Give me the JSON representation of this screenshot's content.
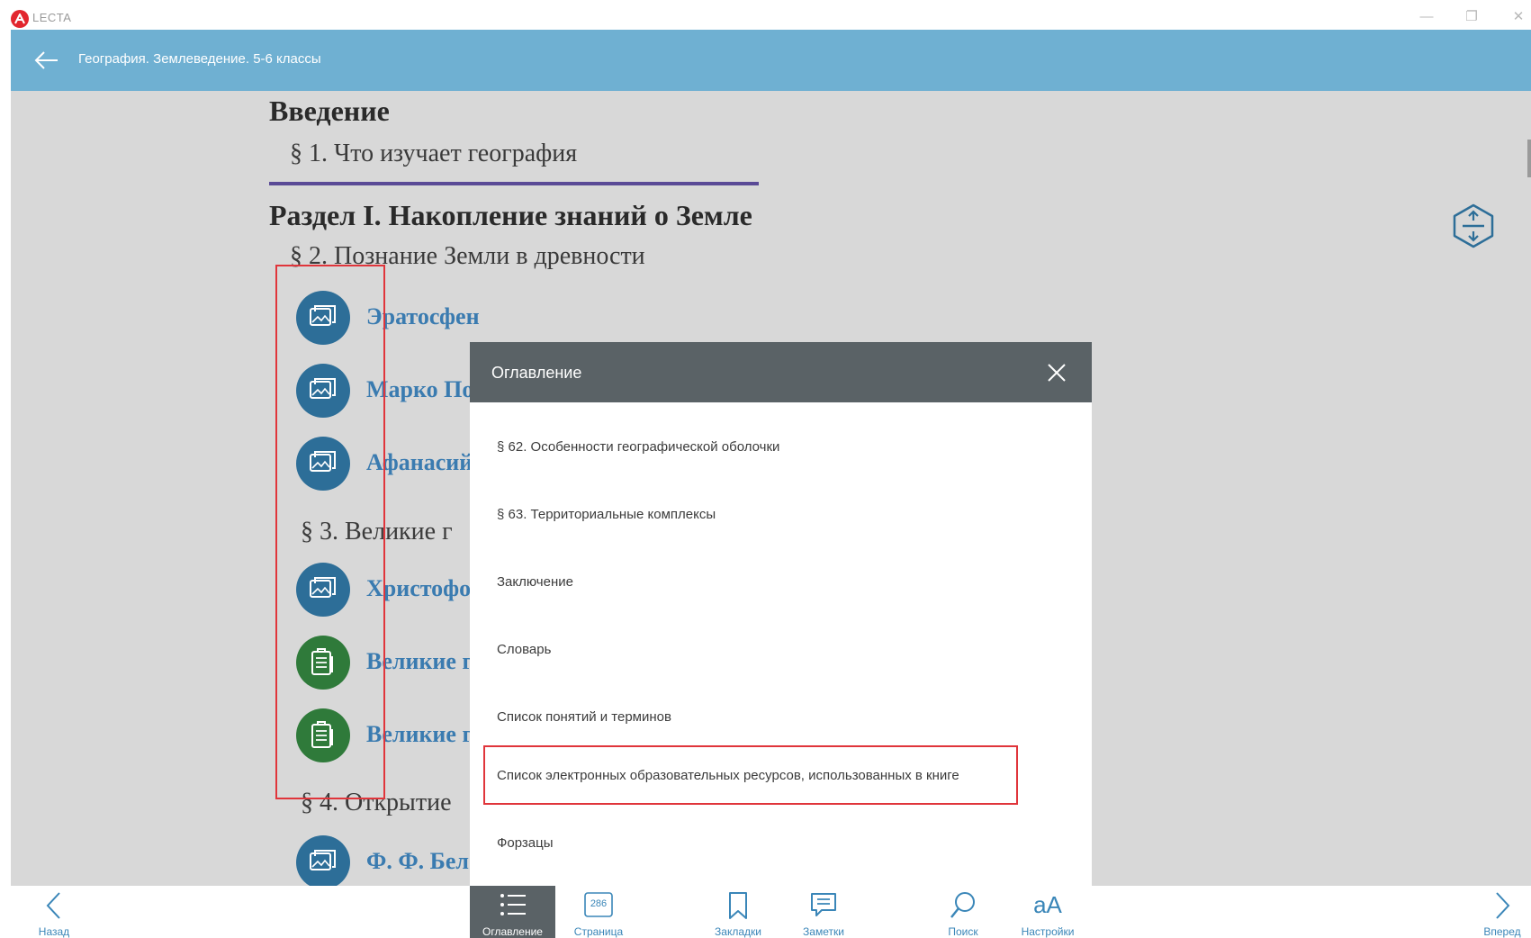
{
  "window": {
    "app_name": "LECTA",
    "minimize_glyph": "—",
    "maximize_glyph": "❐",
    "close_glyph": "✕"
  },
  "header": {
    "title": "География. Землеведение. 5-6 классы",
    "back_icon": "arrow-left-icon"
  },
  "content": {
    "intro_heading": "Введение",
    "para1": "§ 1. Что изучает география",
    "section1_heading": "Раздел I. Накопление знаний о Земле",
    "para2": "§ 2. Познание Земли в древности",
    "link_eratosthenes": "Эратосфен",
    "link_marco_polo": "Марко По",
    "link_afanasy": "Афанасий",
    "para3": "§ 3. Великие г",
    "link_christopher": "Христофо",
    "link_great1": "Великие г",
    "link_great2": "Великие г",
    "para4": "§ 4. Открытие",
    "link_bellingshausen": "Ф. Ф. Бел"
  },
  "toc": {
    "title": "Оглавление",
    "items": [
      "§ 62. Особенности географической оболочки",
      "§ 63. Территориальные комплексы",
      "Заключение",
      "Словарь",
      "Список понятий и терминов",
      "Список электронных образовательных ресурсов, использованных в книге",
      "Форзацы"
    ]
  },
  "toolbar": {
    "back": "Назад",
    "contents": "Оглавление",
    "page_number": "286",
    "page": "Страница",
    "bookmarks": "Закладки",
    "notes": "Заметки",
    "search": "Поиск",
    "settings_glyph": "aA",
    "settings": "Настройки",
    "forward": "Вперед"
  },
  "colors": {
    "header": "#6fb0d2",
    "reading_bg": "#d8d8d8",
    "toc_header": "#5a6266",
    "link": "#3a7bb0",
    "highlight": "#e0353b"
  }
}
